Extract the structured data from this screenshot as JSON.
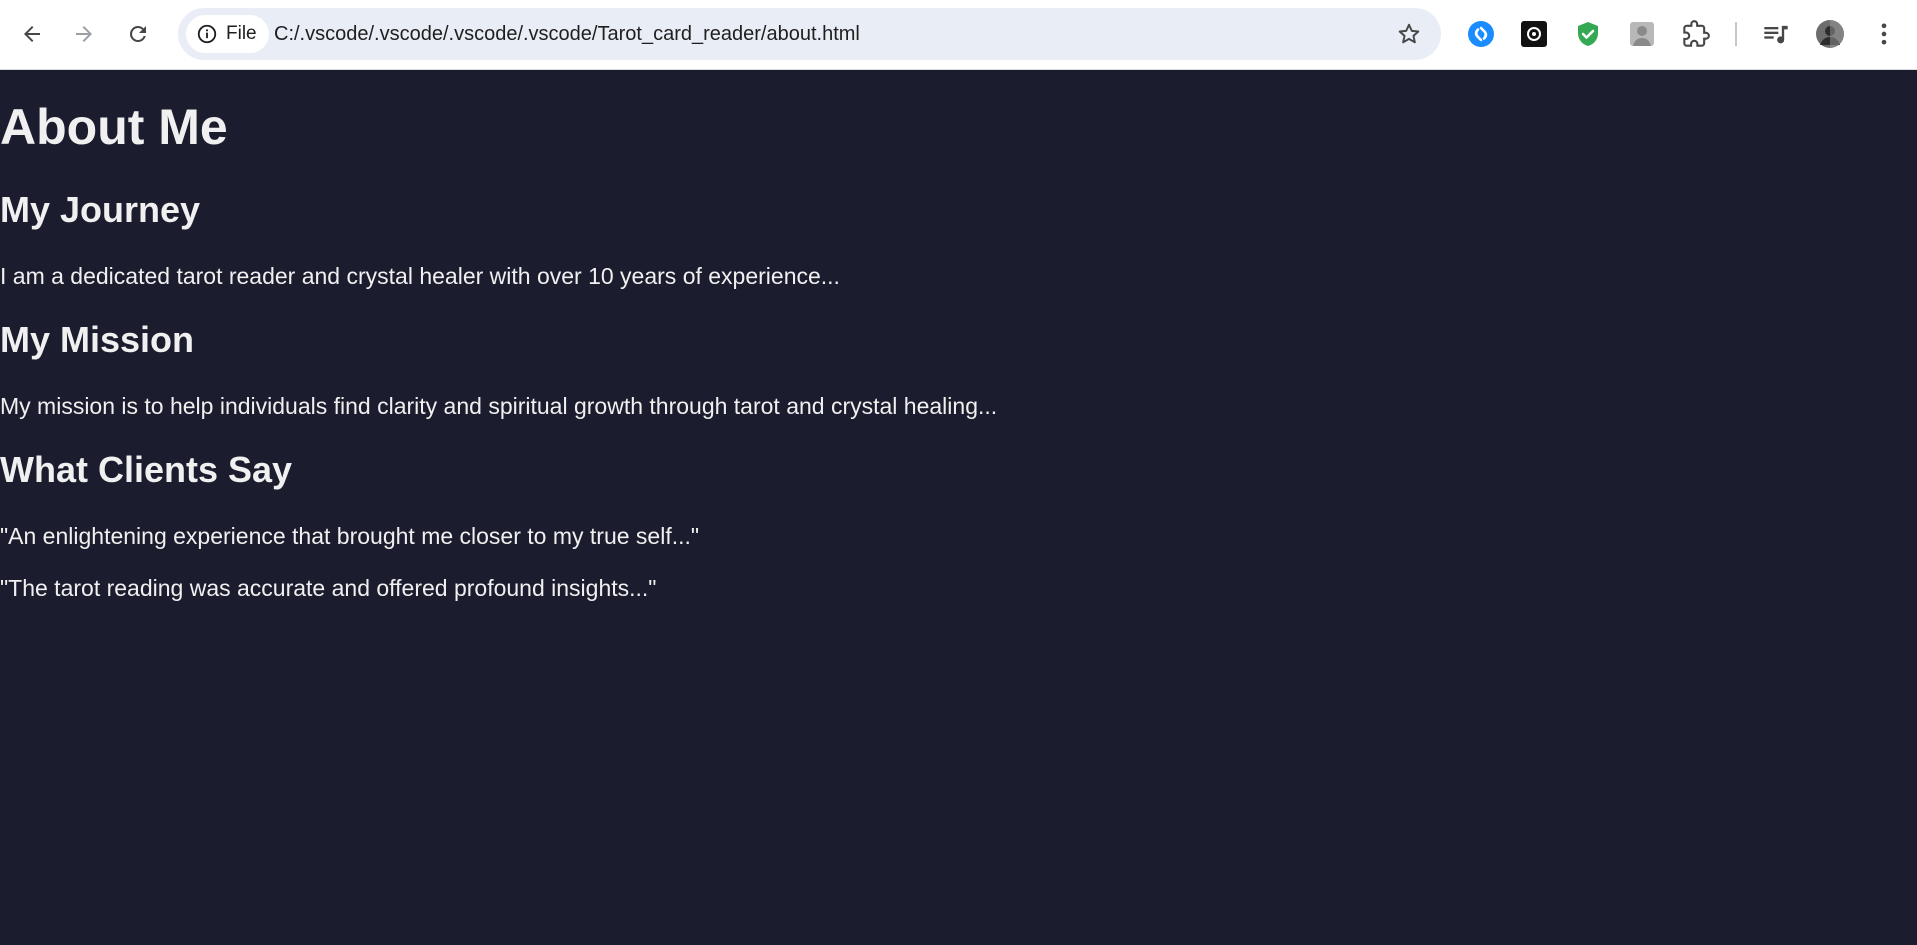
{
  "browser": {
    "url_chip_label": "File",
    "url": "C:/.vscode/.vscode/.vscode/.vscode/Tarot_card_reader/about.html",
    "icons": {
      "back": "arrow-left-icon",
      "forward": "arrow-right-icon",
      "reload": "reload-icon",
      "info": "info-icon",
      "bookmark": "star-icon",
      "extensions": [
        "shazam-icon",
        "chatgpt-icon",
        "shield-check-icon",
        "profile-image-icon",
        "puzzle-icon"
      ],
      "media": "media-queue-icon",
      "avatar": "avatar-icon",
      "menu": "kebab-menu-icon"
    }
  },
  "page": {
    "title": "About Me",
    "sections": [
      {
        "heading": "My Journey",
        "paragraphs": [
          "I am a dedicated tarot reader and crystal healer with over 10 years of experience..."
        ]
      },
      {
        "heading": "My Mission",
        "paragraphs": [
          "My mission is to help individuals find clarity and spiritual growth through tarot and crystal healing..."
        ]
      },
      {
        "heading": "What Clients Say",
        "paragraphs": [
          "\"An enlightening experience that brought me closer to my true self...\"",
          "\"The tarot reading was accurate and offered profound insights...\""
        ]
      }
    ]
  },
  "colors": {
    "page_background": "#1b1c2e",
    "page_text": "#f0f0f0",
    "omnibox": "#e9edf6",
    "shazam_blue": "#1a8cff",
    "shield_green": "#34a853"
  }
}
